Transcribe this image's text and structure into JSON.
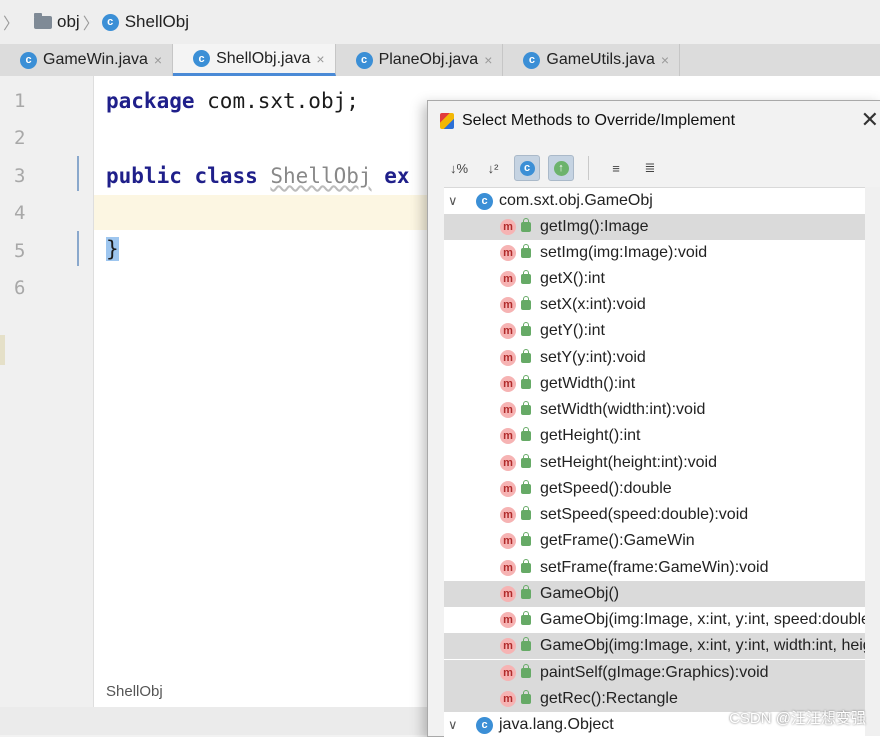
{
  "breadcrumb": {
    "items": [
      "obj",
      "ShellObj"
    ],
    "separator": "〉"
  },
  "tabs": [
    {
      "label": "GameWin.java",
      "active": false
    },
    {
      "label": "ShellObj.java",
      "active": true
    },
    {
      "label": "PlaneObj.java",
      "active": false
    },
    {
      "label": "GameUtils.java",
      "active": false
    }
  ],
  "tab_close_glyph": "×",
  "editor": {
    "line_numbers": [
      "1",
      "2",
      "3",
      "4",
      "5",
      "6"
    ],
    "line1": {
      "kw": "package",
      "rest": " com.sxt.obj;"
    },
    "line3": {
      "kw1": "public",
      "kw2": "class",
      "name": "ShellObj",
      "tail": "ex"
    },
    "line5": "}",
    "file_label": "ShellObj"
  },
  "dialog": {
    "title": "Select Methods to Override/Implement",
    "close_glyph": "✕",
    "toolbar": [
      "↓%",
      "↓²",
      "c",
      "↑",
      "≡",
      "≣"
    ],
    "groups": [
      {
        "name": "com.sxt.obj.GameObj",
        "methods": [
          "getImg():Image",
          "setImg(img:Image):void",
          "getX():int",
          "setX(x:int):void",
          "getY():int",
          "setY(y:int):void",
          "getWidth():int",
          "setWidth(width:int):void",
          "getHeight():int",
          "setHeight(height:int):void",
          "getSpeed():double",
          "setSpeed(speed:double):void",
          "getFrame():GameWin",
          "setFrame(frame:GameWin):void",
          "GameObj()",
          "GameObj(img:Image, x:int, y:int, speed:double)",
          "GameObj(img:Image, x:int, y:int, width:int, heig",
          "paintSelf(gImage:Graphics):void",
          "getRec():Rectangle"
        ]
      },
      {
        "name": "java.lang.Object",
        "methods": []
      }
    ]
  },
  "watermark": "CSDN @汪汪想变强",
  "colors": {
    "accent": "#4a8ad6",
    "class_icon": "#3b8fd6",
    "method_icon": "#f6b3b3"
  }
}
